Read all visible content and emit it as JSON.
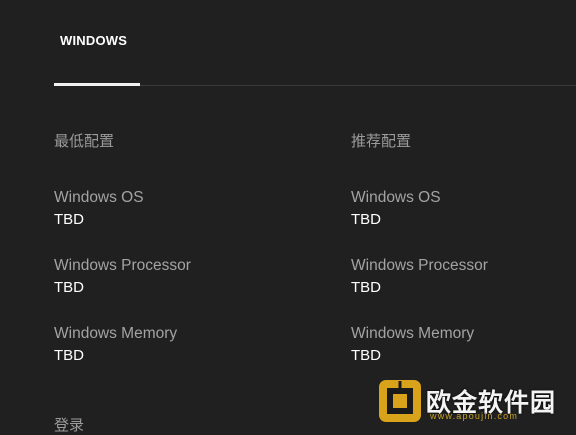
{
  "tabs": [
    {
      "label": "WINDOWS",
      "active": true
    }
  ],
  "minimum": {
    "header": "最低配置",
    "specs": [
      {
        "label": "Windows OS",
        "value": "TBD"
      },
      {
        "label": "Windows Processor",
        "value": "TBD"
      },
      {
        "label": "Windows Memory",
        "value": "TBD"
      }
    ]
  },
  "recommended": {
    "header": "推荐配置",
    "specs": [
      {
        "label": "Windows OS",
        "value": "TBD"
      },
      {
        "label": "Windows Processor",
        "value": "TBD"
      },
      {
        "label": "Windows Memory",
        "value": "TBD"
      }
    ]
  },
  "footer": {
    "login_label": "登录"
  },
  "watermark": {
    "name": "欧金软件园",
    "url": "www.apoujin.com",
    "logo_color": "#d9a21b"
  },
  "colors": {
    "background": "#202020",
    "label": "#a3a3a3",
    "value": "#ffffff"
  }
}
